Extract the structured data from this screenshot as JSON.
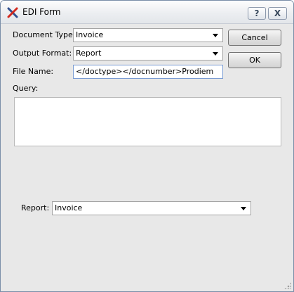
{
  "window": {
    "title": "EDI Form",
    "help_label": "?",
    "close_label": "X"
  },
  "form": {
    "document_type": {
      "label": "Document Type:",
      "value": "Invoice"
    },
    "output_format": {
      "label": "Output Format:",
      "value": "Report"
    },
    "file_name": {
      "label": "File Name:",
      "value": "</doctype></docnumber>Prodiem"
    },
    "query": {
      "label": "Query:",
      "value": ""
    },
    "report": {
      "label": "Report:",
      "value": "Invoice"
    }
  },
  "buttons": {
    "cancel_label": "Cancel",
    "ok_label": "OK"
  },
  "icons": {
    "app": "xtuple-x-icon",
    "dropdown": "chevron-down-icon"
  },
  "colors": {
    "app_icon_red": "#d42a1e",
    "app_icon_blue": "#2f4f8f",
    "input_focus_border": "#7a9cd3"
  }
}
